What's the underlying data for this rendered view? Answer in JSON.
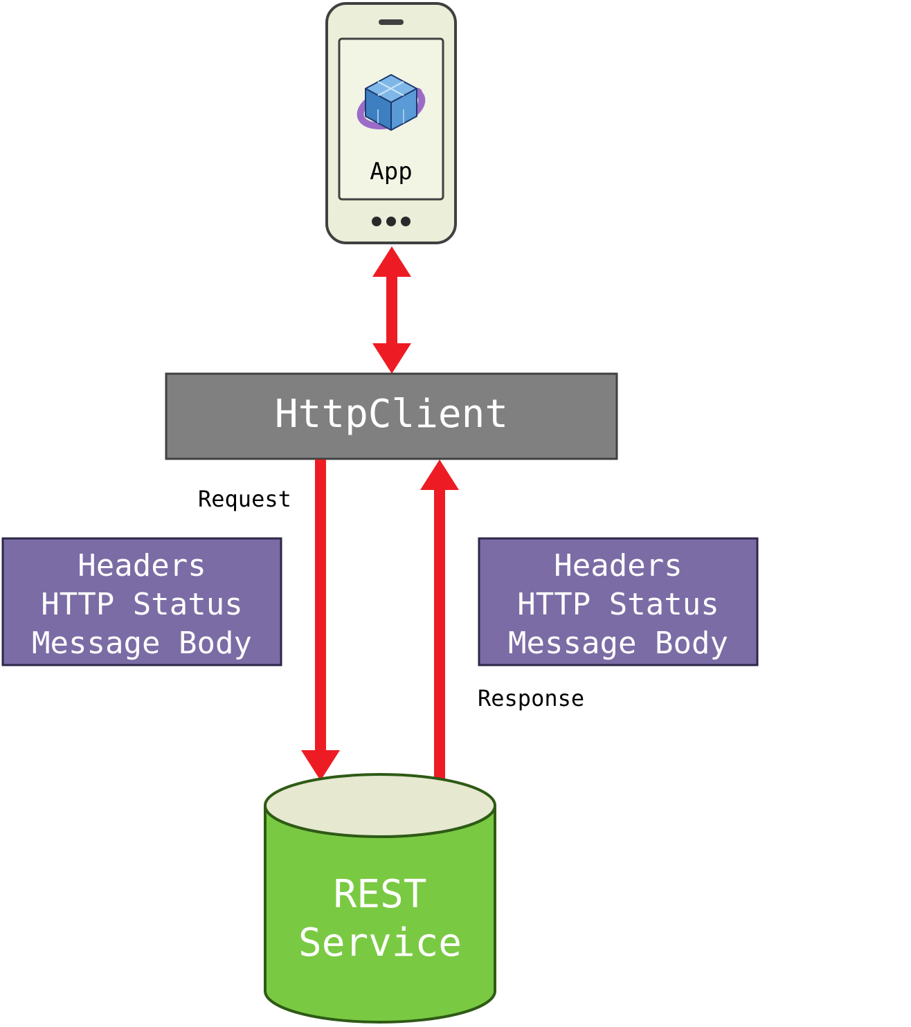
{
  "phone": {
    "app_label": "App"
  },
  "httpclient": {
    "label": "HttpClient"
  },
  "request_label": "Request",
  "response_label": "Response",
  "left_box": {
    "line1": "Headers",
    "line2": "HTTP Status",
    "line3": "Message Body"
  },
  "right_box": {
    "line1": "Headers",
    "line2": "HTTP Status",
    "line3": "Message Body"
  },
  "cylinder": {
    "line1": "REST",
    "line2": "Service"
  },
  "colors": {
    "arrow": "#ed1c24",
    "httpclient_fill": "#808080",
    "box_fill": "#7b6ca5",
    "cyl_fill": "#7ac943",
    "cyl_top": "#e6e8d0",
    "phone_body": "#ebeed8",
    "phone_outline": "#404040"
  }
}
